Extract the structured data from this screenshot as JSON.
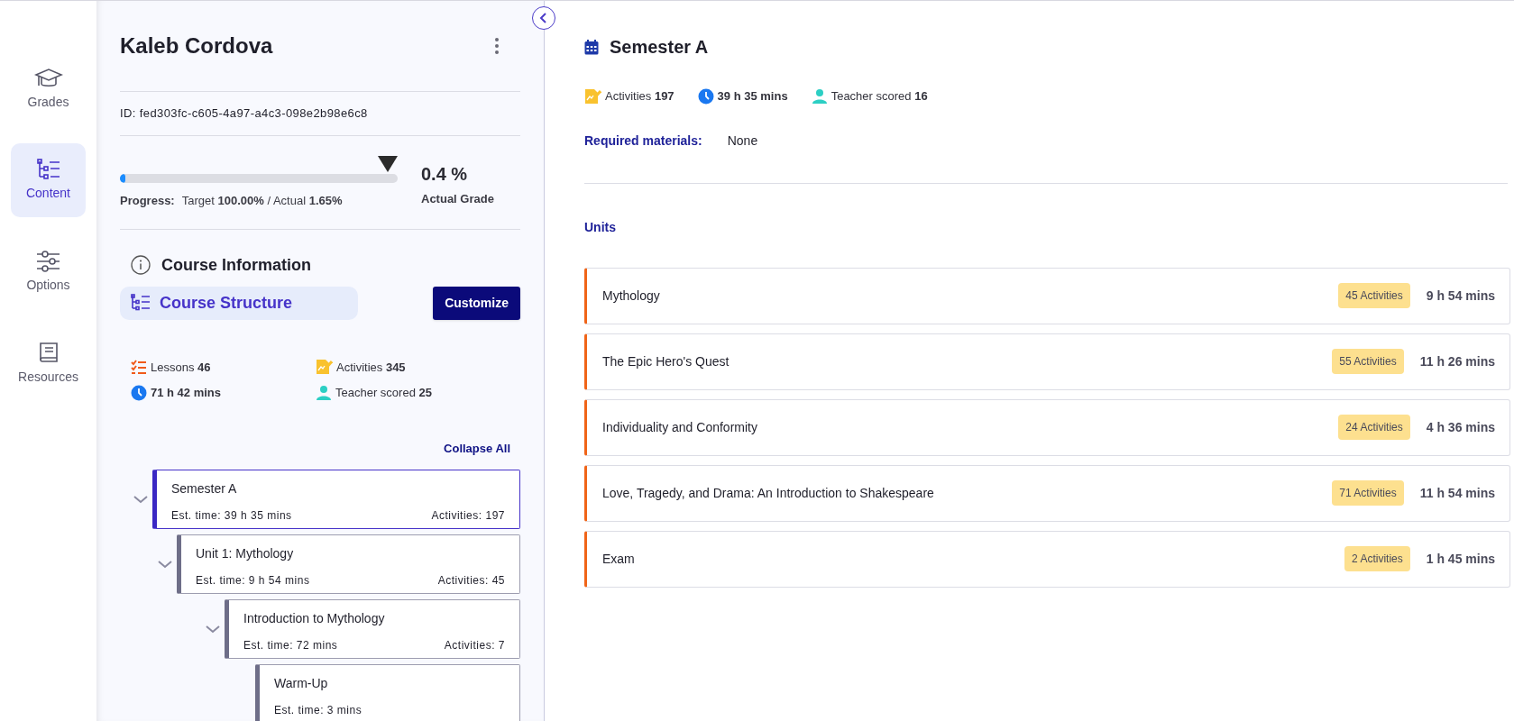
{
  "nav": [
    {
      "label": "Grades",
      "kind": "grades",
      "selected": false
    },
    {
      "label": "Content",
      "kind": "content",
      "selected": true
    },
    {
      "label": "Options",
      "kind": "options",
      "selected": false
    },
    {
      "label": "Resources",
      "kind": "resources",
      "selected": false
    }
  ],
  "student": {
    "name": "Kaleb Cordova",
    "id": "ID: fed303fc-c605-4a97-a4c3-098e2b98e6c8"
  },
  "progress": {
    "label": "Progress:",
    "text": "Target **100.00%** / Actual **1.65%**",
    "level": 0.0165,
    "grade": "0.4 %",
    "grade_label": "Actual Grade"
  },
  "course_info": {
    "title": "Course Information",
    "structure_tab": "Course Structure",
    "customize": "Customize",
    "collapse_all": "Collapse All"
  },
  "course_stats": [
    {
      "kind": "lessons",
      "text": "Lessons **46**"
    },
    {
      "kind": "activities",
      "text": "Activities **345**"
    },
    {
      "kind": "time",
      "text": "**71 h 42 mins**"
    },
    {
      "kind": "teacher",
      "text": "Teacher scored **25**"
    }
  ],
  "tree": [
    {
      "title": "Semester A",
      "time": "Est. time: 39 h 35 mins",
      "activities": "Activities: 197",
      "selected": true,
      "expanded": true,
      "children": [
        {
          "title": "Unit 1: Mythology",
          "time": "Est. time: 9 h 54 mins",
          "activities": "Activities: 45",
          "selected": false,
          "expanded": true,
          "children": [
            {
              "title": "Introduction to Mythology",
              "time": "Est. time: 72 mins",
              "activities": "Activities: 7",
              "selected": false,
              "expanded": true,
              "children": [
                {
                  "title": "Warm-Up",
                  "time": "Est. time: 3 mins",
                  "selected": false
                }
              ]
            }
          ]
        }
      ]
    }
  ],
  "detail": {
    "title": "Semester A",
    "stats": [
      {
        "kind": "activities",
        "text": "Activities **197**"
      },
      {
        "kind": "time",
        "text": "**39 h 35 mins**"
      },
      {
        "kind": "teacher",
        "text": "Teacher scored **16**"
      }
    ],
    "materials_label": "Required materials:",
    "materials_value": "None",
    "units_heading": "Units",
    "units": [
      {
        "name": "Mythology",
        "activities": "45 Activities",
        "time": "9 h 54 mins"
      },
      {
        "name": "The Epic Hero's Quest",
        "activities": "55 Activities",
        "time": "11 h 26 mins"
      },
      {
        "name": "Individuality and Conformity",
        "activities": "24 Activities",
        "time": "4 h 36 mins"
      },
      {
        "name": "Love, Tragedy, and Drama: An Introduction to Shakespeare",
        "activities": "71 Activities",
        "time": "11 h 54 mins"
      },
      {
        "name": "Exam",
        "activities": "2 Activities",
        "time": "1 h 45 mins"
      }
    ]
  }
}
